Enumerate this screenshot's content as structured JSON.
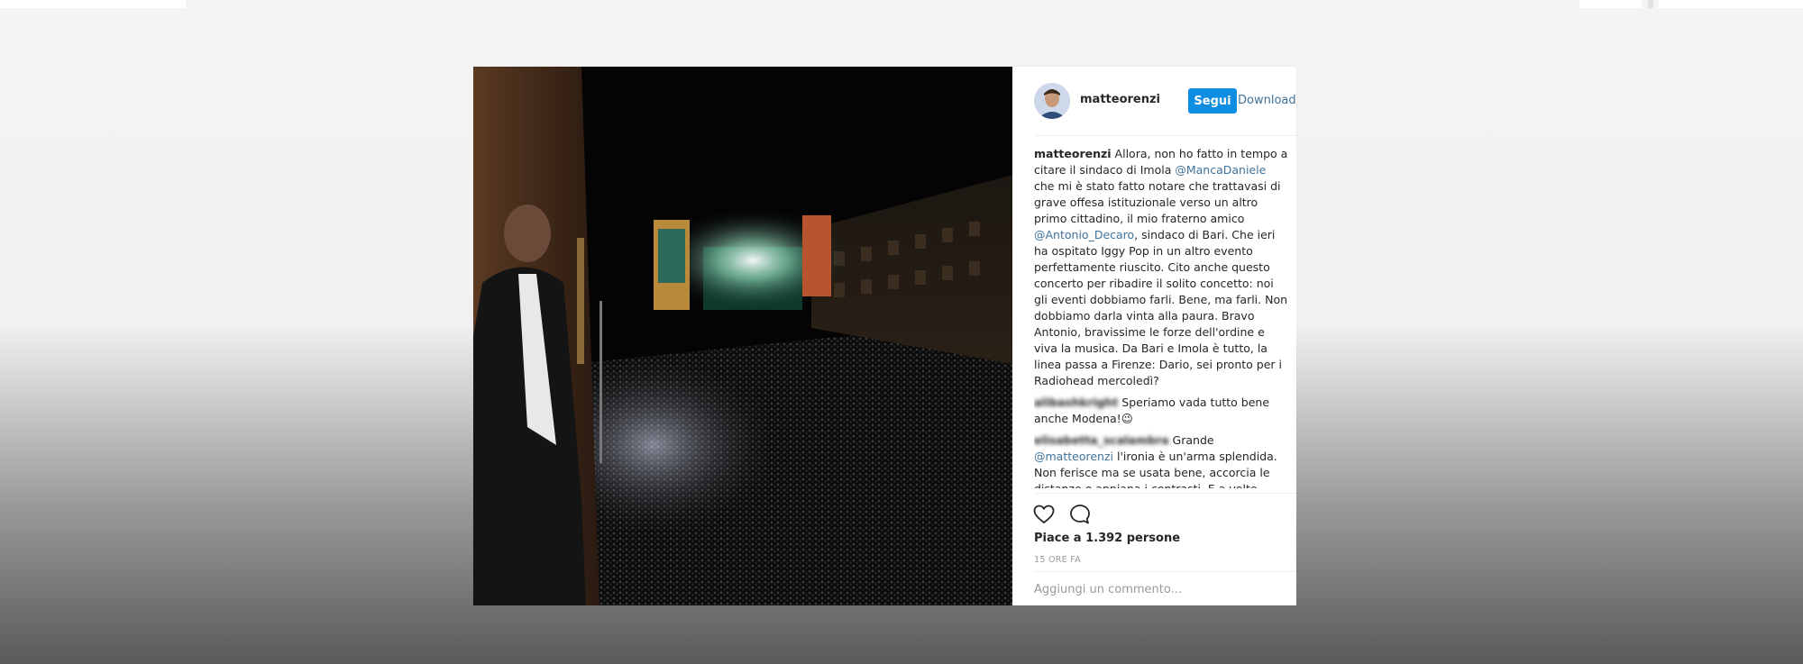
{
  "post": {
    "username": "matteorenzi",
    "follow_label": "Segui",
    "download_label": "Download",
    "caption": {
      "user": "matteorenzi",
      "text_1": " Allora, non ho fatto in tempo a citare il sindaco di Imola ",
      "mention_1": "@MancaDaniele",
      "text_2": " che mi è stato fatto notare che trattavasi di grave offesa istituzionale verso un altro primo cittadino, il mio fraterno amico ",
      "mention_2": "@Antonio_Decaro",
      "text_3": ", sindaco di Bari. Che ieri ha ospitato Iggy Pop in un altro evento perfettamente riuscito. Cito anche questo concerto per ribadire il solito concetto: noi gli eventi dobbiamo farli. Bene, ma farli. Non dobbiamo darla vinta alla paura. Bravo Antonio, bravissime le forze dell'ordine e viva la musica. Da Bari e Imola è tutto, la linea passa a Firenze: Dario, sei pronto per i Radiohead mercoledì?"
    },
    "comments": [
      {
        "user": "alibashkright",
        "text": " Speriamo vada tutto bene anche Modena!😉"
      },
      {
        "user": "elisabetta_scalambra",
        "text_1": " Grande ",
        "mention": "@matteorenzi",
        "text_2": " l'ironia è un'arma splendida. Non ferisce ma se usata bene, accorcia le distanze e appiana i contrasti. E a volte..."
      }
    ],
    "likes_text": "Piace a 1.392 persone",
    "time_text": "15 ORE FA",
    "comment_placeholder": "Aggiungi un commento...",
    "icons": {
      "like": "heart-icon",
      "comment": "comment-icon"
    }
  },
  "colors": {
    "follow_button": "#0f8de1",
    "link": "#3f729b",
    "text": "#262626",
    "muted": "#999999"
  }
}
